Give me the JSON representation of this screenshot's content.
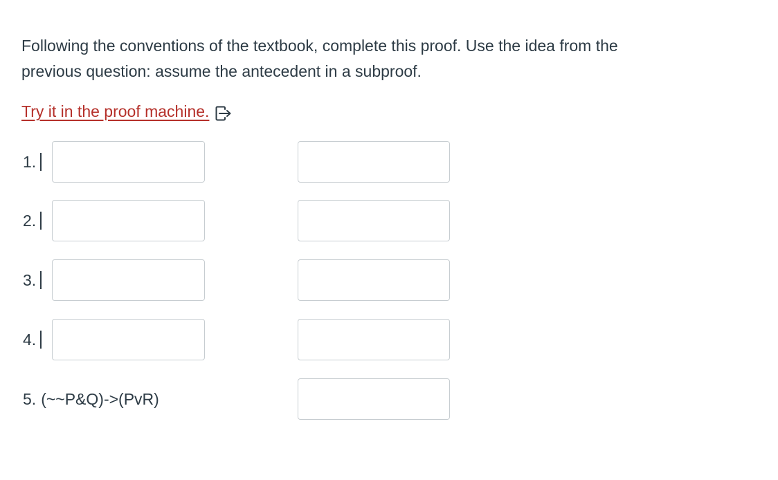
{
  "question": {
    "line1": "Following the conventions of the textbook, complete this proof. Use the idea from the",
    "line2": "previous question: assume the antecedent in a subproof."
  },
  "link": {
    "text": "Try it in the proof machine.",
    "icon": "external-link-icon",
    "color": "#b5302a"
  },
  "proof": {
    "lines": [
      {
        "number": "1.",
        "formula": "",
        "justification": ""
      },
      {
        "number": "2.",
        "formula": "",
        "justification": ""
      },
      {
        "number": "3.",
        "formula": "",
        "justification": ""
      },
      {
        "number": "4.",
        "formula": "",
        "justification": ""
      },
      {
        "number": "5.",
        "conclusion": "(~~P&Q)->(PvR)",
        "justification": ""
      }
    ]
  },
  "colors": {
    "text": "#2d3b45",
    "input_border": "#c7cdd1"
  }
}
